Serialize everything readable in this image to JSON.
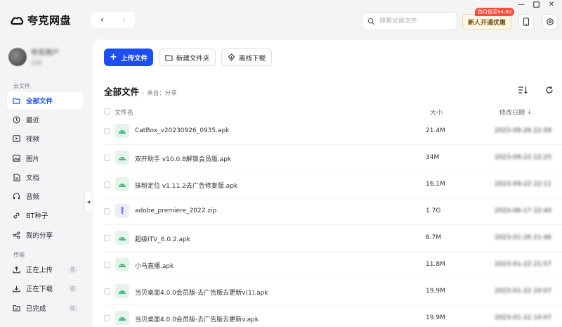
{
  "app": {
    "name": "夸克网盘",
    "brand_color": "#1d4df5",
    "window_controls": [
      "minimize",
      "maximize",
      "close"
    ]
  },
  "toolbar": {
    "back_icon": "chevron-left-icon",
    "forward_icon": "chevron-right-icon",
    "search_placeholder": "搜索全部文件",
    "promo_label": "新人开通优惠",
    "promo_badge": "首月低至¥4.80"
  },
  "user": {
    "name": "夸克用户",
    "subtitle": "容量"
  },
  "sidebar": {
    "cloud_section": "云文件",
    "transfer_section": "传输",
    "cloud_items": [
      {
        "label": "全部文件",
        "icon": "folder-icon",
        "active": true
      },
      {
        "label": "最近",
        "icon": "clock-icon"
      },
      {
        "label": "视频",
        "icon": "video-icon"
      },
      {
        "label": "图片",
        "icon": "image-icon"
      },
      {
        "label": "文档",
        "icon": "document-icon"
      },
      {
        "label": "音频",
        "icon": "headphones-icon"
      },
      {
        "label": "BT种子",
        "icon": "link-icon"
      },
      {
        "label": "我的分享",
        "icon": "share-icon"
      }
    ],
    "transfer_items": [
      {
        "label": "正在上传",
        "icon": "upload-icon",
        "count": "0"
      },
      {
        "label": "正在下载",
        "icon": "download-icon",
        "count": "0"
      },
      {
        "label": "已完成",
        "icon": "check-folder-icon",
        "count": "0"
      }
    ]
  },
  "actions": {
    "upload": "上传文件",
    "new_folder": "新建文件夹",
    "offline_download": "离线下载"
  },
  "breadcrumb": {
    "title": "全部文件",
    "source": "来自：分享"
  },
  "table": {
    "headers": {
      "name": "文件名",
      "size": "大小",
      "date": "修改日期"
    },
    "sort_indicator": "↓",
    "rows": [
      {
        "name": "CatBox_v20230926_0935.apk",
        "size": "21.4M",
        "date": "2023-09-26 22:59",
        "type": "apk"
      },
      {
        "name": "双开助手 v10.0.8解锁会员版.apk",
        "size": "34M",
        "date": "2023-09-22 22:25",
        "type": "apk"
      },
      {
        "name": "抹粉定位 v1.11.2去广告修复版.apk",
        "size": "16.1M",
        "date": "2023-09-22 22:11",
        "type": "apk"
      },
      {
        "name": "adobe_premiere_2022.zip",
        "size": "1.7G",
        "date": "2023-06-17 22:40",
        "type": "zip"
      },
      {
        "name": "超级ITV_6.0.2.apk",
        "size": "6.7M",
        "date": "2023-01-26 21:46",
        "type": "apk"
      },
      {
        "name": "小马直播.apk",
        "size": "11.8M",
        "date": "2023-01-22 21:57",
        "type": "apk"
      },
      {
        "name": "当贝桌面4.0.0会员版-去广告版去更新v(1).apk",
        "size": "19.9M",
        "date": "2023-01-22 10:07",
        "type": "apk"
      },
      {
        "name": "当贝桌面4.0.0会员版-去广告版去更新v.apk",
        "size": "19.9M",
        "date": "2023-01-22 10:07",
        "type": "apk"
      }
    ]
  }
}
